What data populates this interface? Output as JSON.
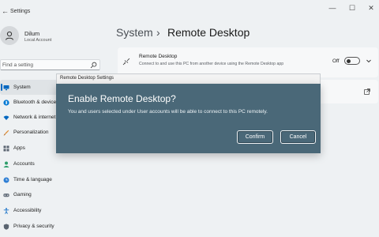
{
  "window": {
    "app_title": "Settings",
    "back_glyph": "←",
    "controls": {
      "minimize": "—",
      "maximize": "☐",
      "close": "✕"
    }
  },
  "profile": {
    "name": "Dilum",
    "account_type": "Local Account"
  },
  "search": {
    "placeholder": "Find a setting",
    "icon": "search-icon"
  },
  "sidebar": {
    "items": [
      {
        "label": "System",
        "icon": "monitor-icon",
        "color": "#0067c0",
        "active": true
      },
      {
        "label": "Bluetooth & devices",
        "icon": "bluetooth-icon",
        "color": "#0078d4"
      },
      {
        "label": "Network & internet",
        "icon": "wifi-icon",
        "color": "#0067c0"
      },
      {
        "label": "Personalization",
        "icon": "brush-icon",
        "color": "#e08a2e"
      },
      {
        "label": "Apps",
        "icon": "apps-icon",
        "color": "#5a6470"
      },
      {
        "label": "Accounts",
        "icon": "person-icon",
        "color": "#2e9e6b"
      },
      {
        "label": "Time & language",
        "icon": "globe-clock-icon",
        "color": "#2e7ed4"
      },
      {
        "label": "Gaming",
        "icon": "gamepad-icon",
        "color": "#6a7480"
      },
      {
        "label": "Accessibility",
        "icon": "accessibility-icon",
        "color": "#1a73c8"
      },
      {
        "label": "Privacy & security",
        "icon": "shield-icon",
        "color": "#5a6470"
      }
    ]
  },
  "breadcrumb": {
    "root": "System",
    "separator": "›",
    "current": "Remote Desktop"
  },
  "remote_desktop_card": {
    "title": "Remote Desktop",
    "description": "Connect to and use this PC from another device using the Remote Desktop app",
    "toggle_state": "Off",
    "toggle_on": false
  },
  "dialog": {
    "caption": "Remote Desktop Settings",
    "heading": "Enable Remote Desktop?",
    "message": "You and users selected under User accounts will be able to connect to this PC remotely.",
    "confirm_label": "Confirm",
    "cancel_label": "Cancel",
    "background_color": "#4a6878"
  }
}
